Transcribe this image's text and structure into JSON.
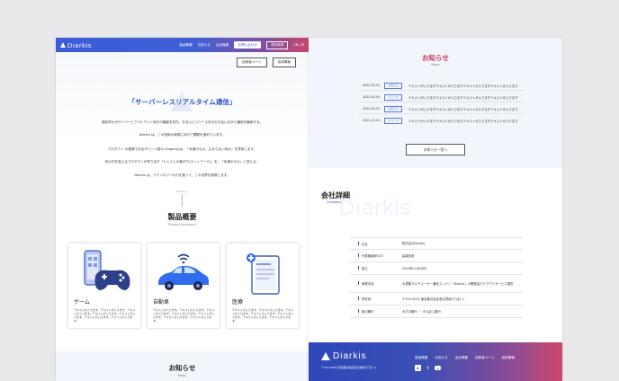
{
  "header": {
    "logo": "Diarkis",
    "nav": [
      "製品概要",
      "お知らせ",
      "会社概要"
    ],
    "contact_button": "お問い合わせ",
    "docs_button": "資料請求",
    "lang": "EN / JP"
  },
  "hero": {
    "sub_buttons": [
      "技術者ページ",
      "採用情報"
    ],
    "title": "「サーバーレスリアルタイム通信」",
    "lines": [
      "端末同士がサーバーとクライアント両方の機能を持ち、お互いにリソースを分かち合いながら通信を継続する。",
      "Diarkis は、この技術の実現に向けて開発を進めています。",
      "プロダクト の語源であるギリシャ語の (Sugeny)は、「永遠のもの、止まらない何か」を意味します。",
      "世の中を変えるプロダクトが作り出す「人と人との繋がり(ネットワーク)」を、「永遠のもの」に変える。",
      "Diarkis は、テクノロジーの力を使って、この世界を実現します。"
    ],
    "scroll": "SCROLL"
  },
  "products": {
    "title": "製品概要",
    "subtitle": "Product Summary",
    "cards": [
      {
        "title": "ゲーム",
        "icon": "game-controller-icon",
        "text": "テキストが入ります。テキストが入ります。テキストが入ります。テキストが入ります。テキストが入ります。テキストが入ります。テキストが入ります。"
      },
      {
        "title": "自動車",
        "icon": "car-icon",
        "text": "テキストが入ります。テキストが入ります。テキストが入ります。テキストが入ります。テキストが入ります。テキストが入ります。テキストが入ります。"
      },
      {
        "title": "医療",
        "icon": "medical-tablet-icon",
        "text": "テキストが入ります。テキストが入ります。テキストが入ります。テキストが入ります。テキストが入ります。テキストが入ります。テキストが入ります。"
      }
    ]
  },
  "news": {
    "title": "お知らせ",
    "subtitle": "News",
    "items": [
      {
        "date": "2022.01.01",
        "tag": "お知らせ",
        "text": "テキストが入りますテキストが入りますテキストが入りますテキストが入ります"
      },
      {
        "date": "2022.01.01",
        "tag": "ニュース",
        "text": "テキストが入りますテキストが入りますテキストが入りますテキストが入ります"
      },
      {
        "date": "2022.01.01",
        "tag": "お知らせ",
        "text": "テキストが入りますテキストが入りますテキストが入りますテキストが入ります"
      },
      {
        "date": "2022.01.01",
        "tag": "ニュース",
        "text": "テキストが入りますテキストが入りますテキストが入りますテキストが入ります"
      }
    ],
    "more_button": "お知らせ一覧へ"
  },
  "company": {
    "title": "会社詳細",
    "subtitle": "Company",
    "watermark": "Diarkis",
    "rows": [
      {
        "label": "社名",
        "value": "株式会社Diarkis"
      },
      {
        "label": "代表取締役CEO",
        "value": "高橋伯彦"
      },
      {
        "label": "設立",
        "value": "2019年11月28日"
      },
      {
        "label": "事業内容",
        "value": "大規模マルチユーザー通信エンジン「Diarkis」の開発及びクラウドサービス提供"
      },
      {
        "label": "所在地",
        "value": "〒150-0022 東京都渋谷区恵比寿南3丁目1-1"
      },
      {
        "label": "取引銀行",
        "value": "みずほ銀行 ・ きらぼし銀行"
      }
    ]
  },
  "footer": {
    "logo": "Diarkis",
    "address": "〒150-0022 東京都渋谷区恵比寿南3丁目1-1",
    "nav": [
      "製品概要",
      "お知らせ",
      "会社概要",
      "技術者ページ",
      "採用情報"
    ],
    "social": [
      "in",
      "t",
      ""
    ]
  },
  "colors": {
    "primary": "#2b52c9",
    "accent": "#c23a5a"
  }
}
